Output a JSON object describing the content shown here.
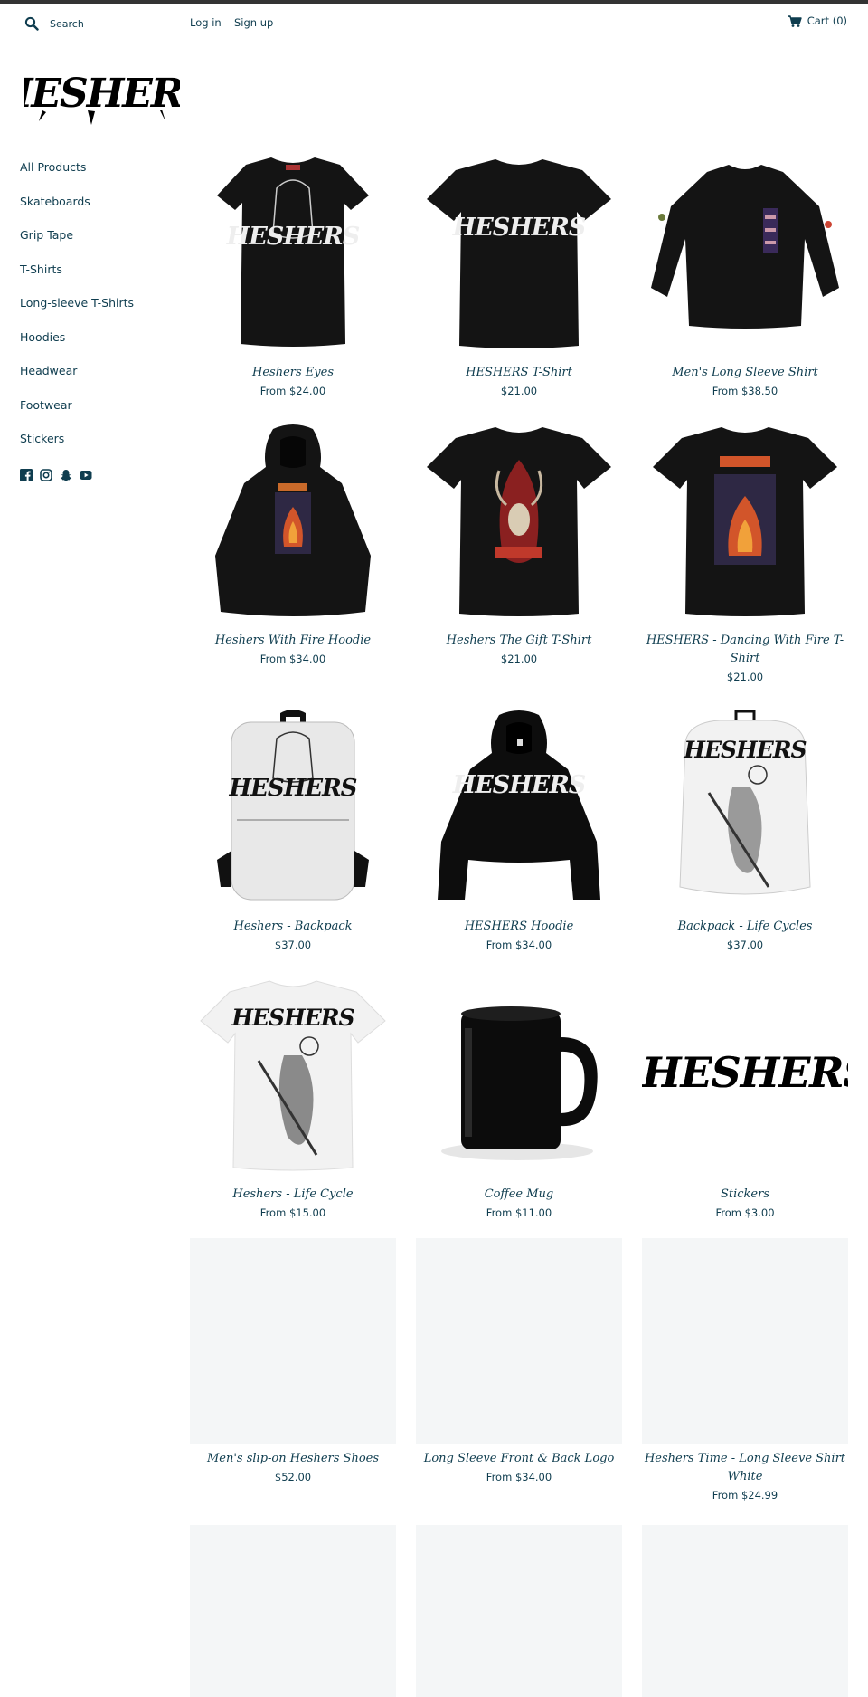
{
  "header": {
    "search_placeholder": "Search",
    "login": "Log in",
    "signup": "Sign up",
    "cart": "Cart (0)"
  },
  "brand": {
    "logo_text": "HESHERS"
  },
  "sidebar": {
    "items": [
      {
        "label": "All Products"
      },
      {
        "label": "Skateboards"
      },
      {
        "label": "Grip Tape"
      },
      {
        "label": "T-Shirts"
      },
      {
        "label": "Long-sleeve T-Shirts"
      },
      {
        "label": "Hoodies"
      },
      {
        "label": "Headwear"
      },
      {
        "label": "Footwear"
      },
      {
        "label": "Stickers"
      }
    ],
    "social": [
      "facebook-icon",
      "instagram-icon",
      "snapchat-icon",
      "youtube-icon"
    ]
  },
  "products": [
    {
      "title": "Heshers Eyes",
      "price": "From $24.00",
      "image": "black-tshirt"
    },
    {
      "title": "HESHERS T-Shirt",
      "price": "$21.00",
      "image": "black-tshirt"
    },
    {
      "title": "Men's Long Sleeve Shirt",
      "price": "From $38.50",
      "image": "black-longsleeve"
    },
    {
      "title": "Heshers With Fire Hoodie",
      "price": "From $34.00",
      "image": "black-hoodie"
    },
    {
      "title": "Heshers The Gift T-Shirt",
      "price": "$21.00",
      "image": "black-tshirt"
    },
    {
      "title": "HESHERS - Dancing With Fire T-Shirt",
      "price": "$21.00",
      "image": "black-tshirt"
    },
    {
      "title": "Heshers - Backpack",
      "price": "$37.00",
      "image": "white-backpack"
    },
    {
      "title": "HESHERS Hoodie",
      "price": "From $34.00",
      "image": "black-hoodie"
    },
    {
      "title": "Backpack - Life Cycles",
      "price": "$37.00",
      "image": "white-backpack"
    },
    {
      "title": "Heshers - Life Cycle",
      "price": "From $15.00",
      "image": "white-tshirt"
    },
    {
      "title": "Coffee Mug",
      "price": "From $11.00",
      "image": "black-mug"
    },
    {
      "title": "Stickers",
      "price": "From $3.00",
      "image": "sticker"
    },
    {
      "title": "Men's slip-on Heshers Shoes",
      "price": "$52.00",
      "image": "placeholder"
    },
    {
      "title": "Long Sleeve Front & Back Logo",
      "price": "From $34.00",
      "image": "placeholder"
    },
    {
      "title": "Heshers Time - Long Sleeve Shirt White",
      "price": "From $24.99",
      "image": "placeholder"
    },
    {
      "title": "",
      "price": "",
      "image": "placeholder"
    },
    {
      "title": "",
      "price": "",
      "image": "placeholder"
    },
    {
      "title": "",
      "price": "",
      "image": "placeholder"
    }
  ],
  "colors": {
    "text": "#0f3d4f",
    "topbar": "#333333",
    "placeholder": "#f4f6f7",
    "fire": "#d2552a"
  }
}
